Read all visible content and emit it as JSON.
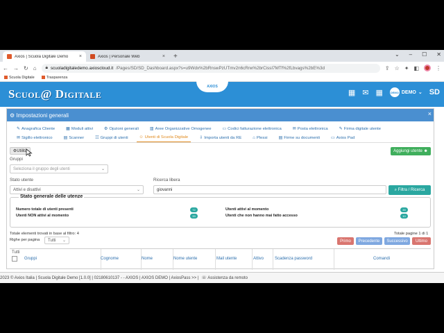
{
  "browser": {
    "tabs": [
      {
        "title": "Axios | Scuola Digitale Demo",
        "close": "×"
      },
      {
        "title": "Axios | Personale Web",
        "close": "×"
      }
    ],
    "new_tab": "+",
    "url_domain": "scuoladigitaledemo.axioscloud.it",
    "url_path": "/Pages/SD/SD_Dashboard.aspx?s=u9Wdx%2bRnswPzUTmv2n6cRrw%2brCissI7MTf%2fLbvags%2bE%3d",
    "bookmarks": [
      "Scuola Digitale",
      "Trasparenza"
    ]
  },
  "app": {
    "logo": "Scuol@ Digitale",
    "axios_badge": "AXIOS",
    "user": "DEMO",
    "avatar_text": "DEMO",
    "sd": "SD"
  },
  "panel": {
    "title": "Impostazioni generali",
    "close": "×",
    "nav_row1": [
      {
        "icon": "✎",
        "label": "Anagrafica Cliente"
      },
      {
        "icon": "▦",
        "label": "Moduli attivi"
      },
      {
        "icon": "⚙",
        "label": "Opzioni generali"
      },
      {
        "icon": "▥",
        "label": "Aree Organizzative Omogenee"
      },
      {
        "icon": "▭",
        "label": "Codici fatturazione elettronica"
      },
      {
        "icon": "✉",
        "label": "Posta elettronica"
      },
      {
        "icon": "✎",
        "label": "Firma digitale utente"
      }
    ],
    "nav_row2": [
      {
        "icon": "✉",
        "label": "Sigillo elettronico"
      },
      {
        "icon": "▤",
        "label": "Scanner"
      },
      {
        "icon": "☷",
        "label": "Gruppi di utenti"
      },
      {
        "icon": "☺",
        "label": "Utenti di Scuola Digitale"
      },
      {
        "icon": "⇩",
        "label": "Importa utenti da RE"
      },
      {
        "icon": "⌂",
        "label": "Plessi"
      },
      {
        "icon": "▤",
        "label": "Firme su documenti"
      },
      {
        "icon": "▭",
        "label": "Axios Pad"
      }
    ],
    "utilita_label": "Utilità",
    "add_user_label": "Aggiungi utente",
    "gruppi_label": "Gruppi",
    "gruppi_placeholder": "Seleziona il gruppo degli utenti",
    "stato_label": "Stato utente",
    "stato_value": "Attivi e disattivi",
    "ricerca_label": "Ricerca libera",
    "ricerca_value": "giovanni",
    "filtra_label": "Filtra / Ricerca",
    "stato_generale": {
      "legend": "Stato generale delle utenze",
      "items": [
        {
          "label": "Numero totale di utenti presenti",
          "value": "72"
        },
        {
          "label": "Utenti NON attivi al momento",
          "value": "33"
        },
        {
          "label": "Utenti attivi al momento",
          "value": "39"
        },
        {
          "label": "Utenti che non hanno mai fatto accesso",
          "value": "10"
        }
      ]
    },
    "totale_elementi": "Totale elementi trovati in base al filtro: 4",
    "totale_pagine": "Totale pagine 1 di 1",
    "righe_label": "Righe per pagina",
    "righe_value": "Tutti",
    "pager": {
      "primo": "Primo",
      "precedente": "Precedente",
      "successivo": "Successivo",
      "ultimo": "Ultimo"
    },
    "columns": [
      "Tutti",
      "Gruppi",
      "Cognome",
      "Nome",
      "Nome utente",
      "Mail utente",
      "Attivo",
      "Scadenza password",
      "Comandi"
    ]
  },
  "footer": {
    "text": "2023 © Axios Italia |   Scuola Digitale Demo [1.0.0] |   02180610137 - - AXIOS |   AXIOS DEMO |   AxiosPass >> |",
    "assist": "Assistenza da remoto"
  },
  "colors": {
    "header": "#2c8fd6",
    "panel_head": "#4a8fd0",
    "green": "#3fae5c",
    "teal": "#2aa7a0"
  }
}
